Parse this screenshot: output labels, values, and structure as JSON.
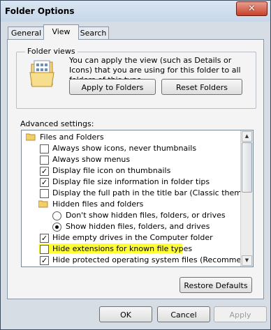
{
  "window": {
    "title": "Folder Options",
    "close_glyph": "✕"
  },
  "tabs": [
    {
      "label": "General",
      "active": false
    },
    {
      "label": "View",
      "active": true
    },
    {
      "label": "Search",
      "active": false
    }
  ],
  "folder_views": {
    "group_label": "Folder views",
    "description": "You can apply the view (such as Details or Icons) that you are using for this folder to all folders of this type.",
    "apply_button": "Apply to Folders",
    "reset_button": "Reset Folders"
  },
  "advanced": {
    "label": "Advanced settings:",
    "items": [
      {
        "type": "folder",
        "label": "Files and Folders"
      },
      {
        "type": "checkbox",
        "label": "Always show icons, never thumbnails",
        "checked": false
      },
      {
        "type": "checkbox",
        "label": "Always show menus",
        "checked": false
      },
      {
        "type": "checkbox",
        "label": "Display file icon on thumbnails",
        "checked": true
      },
      {
        "type": "checkbox",
        "label": "Display file size information in folder tips",
        "checked": true
      },
      {
        "type": "checkbox",
        "label": "Display the full path in the title bar (Classic theme only)",
        "checked": false
      },
      {
        "type": "folder",
        "label": "Hidden files and folders"
      },
      {
        "type": "radio",
        "label": "Don't show hidden files, folders, or drives",
        "selected": false
      },
      {
        "type": "radio",
        "label": "Show hidden files, folders, and drives",
        "selected": true
      },
      {
        "type": "checkbox",
        "label": "Hide empty drives in the Computer folder",
        "checked": true
      },
      {
        "type": "checkbox",
        "label": "Hide extensions for known file types",
        "checked": false,
        "highlighted": true
      },
      {
        "type": "checkbox",
        "label": "Hide protected operating system files (Recommended)",
        "checked": true
      }
    ],
    "check_glyph": "✓",
    "highlight_color": "#ffff33"
  },
  "buttons": {
    "restore_defaults": "Restore Defaults",
    "ok": "OK",
    "cancel": "Cancel",
    "apply": "Apply"
  },
  "icons": {
    "folder": "folder-icon",
    "folder_view": "folder-view-icon",
    "scroll_up": "▲",
    "scroll_down": "▼"
  }
}
